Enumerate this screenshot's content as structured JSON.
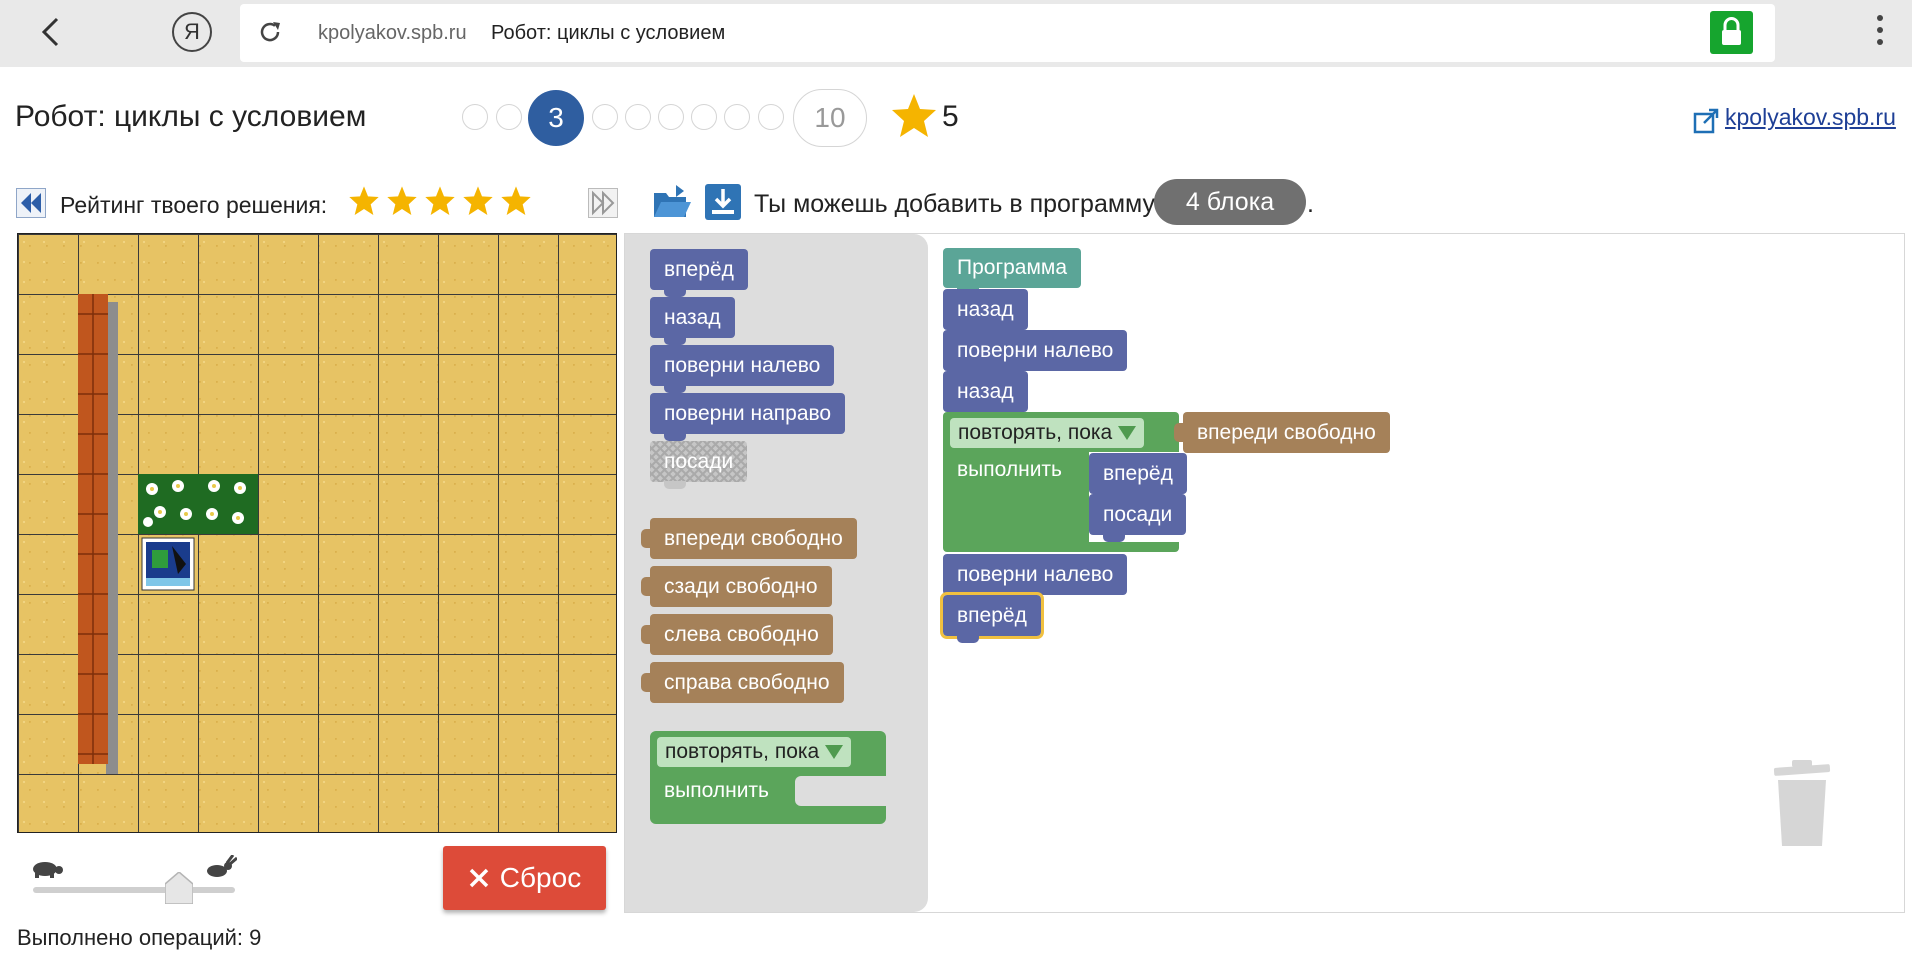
{
  "browser": {
    "back_icon": "chevron-left-icon",
    "yandex_logo": "Я",
    "reload_icon": "reload-icon",
    "domain": "kpolyakov.spb.ru",
    "tab_title": "Робот: циклы с условием",
    "lock_icon": "lock-icon",
    "menu_icon": "more-vertical-icon"
  },
  "header": {
    "title": "Робот: циклы с условием",
    "current_level": "3",
    "last_level": "10",
    "stars": "5",
    "site_link": "kpolyakov.spb.ru"
  },
  "rating": {
    "label": "Рейтинг твоего решения:",
    "stars_filled": 5,
    "stars_total": 5
  },
  "toolbar": {
    "add_label": "Ты можешь добавить в программу",
    "blocks_left": "4 блока",
    "dot": "."
  },
  "toolbox": {
    "move_forward": "вперёд",
    "move_back": "назад",
    "turn_left": "поверни налево",
    "turn_right": "поверни направо",
    "plant": "посади",
    "front_free": "впереди свободно",
    "back_free": "сзади свободно",
    "left_free": "слева свободно",
    "right_free": "справа свободно",
    "repeat_while": "повторять, пока",
    "do": "выполнить"
  },
  "program": {
    "header": "Программа",
    "b1": "назад",
    "b2": "поверни налево",
    "b3": "назад",
    "loop_label": "повторять, пока",
    "loop_condition": "впереди свободно",
    "loop_do": "выполнить",
    "loop_body_1": "вперёд",
    "loop_body_2": "посади",
    "b4": "поверни налево",
    "b5": "вперёд"
  },
  "controls": {
    "reset_label": "Сброс",
    "ops_label": "Выполнено операций: 9",
    "speed_level": 0.65
  },
  "colors": {
    "level_active": "#2f5ea0",
    "reset": "#dd4b39",
    "motion_block": "#5b67a5",
    "sensor_block": "#a58159",
    "loop_block": "#5ba55b",
    "program_block": "#5ba597"
  }
}
